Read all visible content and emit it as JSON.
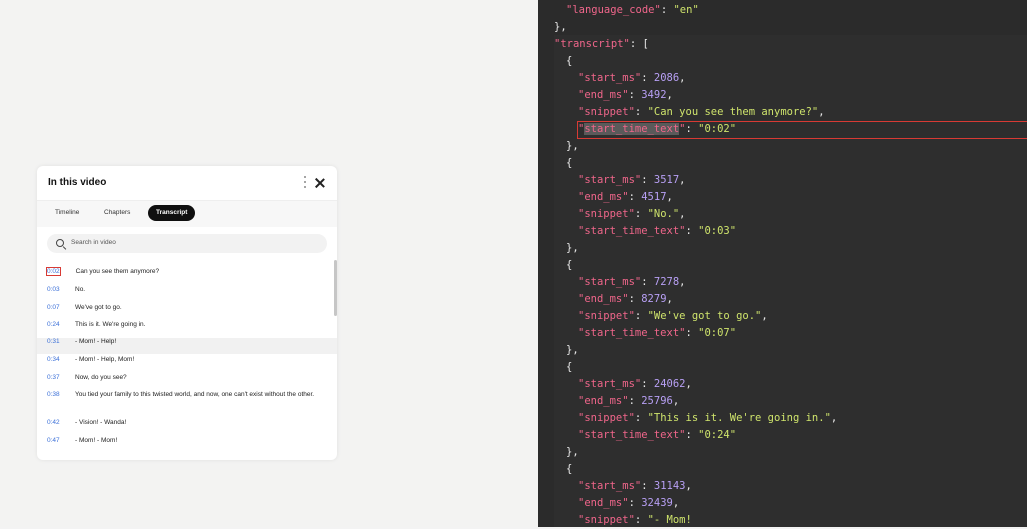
{
  "panel": {
    "title": "In this video",
    "tabs": [
      "Timeline",
      "Chapters",
      "Transcript"
    ],
    "active_tab": "Transcript",
    "search_placeholder": "Search in video",
    "items": [
      {
        "time": "0:02",
        "text": "Can you see them anymore?"
      },
      {
        "time": "0:03",
        "text": "No."
      },
      {
        "time": "0:07",
        "text": "We've got to go."
      },
      {
        "time": "0:24",
        "text": "This is it. We're going in."
      },
      {
        "time": "0:31",
        "text": "- Mom! - Help!"
      },
      {
        "time": "0:34",
        "text": "- Mom! - Help, Mom!"
      },
      {
        "time": "0:37",
        "text": "Now, do you see?"
      },
      {
        "time": "0:38",
        "text": "You tied your family to this twisted world, and now, one can't exist without the other."
      },
      {
        "time": "0:42",
        "text": "- Vision! - Wanda!"
      },
      {
        "time": "0:47",
        "text": "- Mom! - Mom!"
      }
    ]
  },
  "editor": {
    "lines": [
      {
        "indent": 28,
        "parts": [
          [
            "k",
            "\"language_code\""
          ],
          [
            "p",
            ": "
          ],
          [
            "s",
            "\"en\""
          ]
        ]
      },
      {
        "indent": 16,
        "parts": [
          [
            "p",
            "},"
          ]
        ]
      },
      {
        "indent": 16,
        "parts": [
          [
            "k",
            "\"transcript\""
          ],
          [
            "p",
            ": ["
          ]
        ]
      },
      {
        "indent": 28,
        "parts": [
          [
            "p",
            "{"
          ]
        ]
      },
      {
        "indent": 40,
        "parts": [
          [
            "k",
            "\"start_ms\""
          ],
          [
            "p",
            ": "
          ],
          [
            "n",
            "2086"
          ],
          [
            "p",
            ","
          ]
        ]
      },
      {
        "indent": 40,
        "parts": [
          [
            "k",
            "\"end_ms\""
          ],
          [
            "p",
            ": "
          ],
          [
            "n",
            "3492"
          ],
          [
            "p",
            ","
          ]
        ]
      },
      {
        "indent": 40,
        "parts": [
          [
            "k",
            "\"snippet\""
          ],
          [
            "p",
            ": "
          ],
          [
            "s",
            "\"Can you see them anymore?\""
          ],
          [
            "p",
            ","
          ]
        ]
      },
      {
        "indent": 40,
        "parts": [
          [
            "k",
            "\"start_time_text\""
          ],
          [
            "p",
            ": "
          ],
          [
            "s",
            "\"0:02\""
          ]
        ]
      },
      {
        "indent": 28,
        "parts": [
          [
            "p",
            "},"
          ]
        ]
      },
      {
        "indent": 28,
        "parts": [
          [
            "p",
            "{"
          ]
        ]
      },
      {
        "indent": 40,
        "parts": [
          [
            "k",
            "\"start_ms\""
          ],
          [
            "p",
            ": "
          ],
          [
            "n",
            "3517"
          ],
          [
            "p",
            ","
          ]
        ]
      },
      {
        "indent": 40,
        "parts": [
          [
            "k",
            "\"end_ms\""
          ],
          [
            "p",
            ": "
          ],
          [
            "n",
            "4517"
          ],
          [
            "p",
            ","
          ]
        ]
      },
      {
        "indent": 40,
        "parts": [
          [
            "k",
            "\"snippet\""
          ],
          [
            "p",
            ": "
          ],
          [
            "s",
            "\"No.\""
          ],
          [
            "p",
            ","
          ]
        ]
      },
      {
        "indent": 40,
        "parts": [
          [
            "k",
            "\"start_time_text\""
          ],
          [
            "p",
            ": "
          ],
          [
            "s",
            "\"0:03\""
          ]
        ]
      },
      {
        "indent": 28,
        "parts": [
          [
            "p",
            "},"
          ]
        ]
      },
      {
        "indent": 28,
        "parts": [
          [
            "p",
            "{"
          ]
        ]
      },
      {
        "indent": 40,
        "parts": [
          [
            "k",
            "\"start_ms\""
          ],
          [
            "p",
            ": "
          ],
          [
            "n",
            "7278"
          ],
          [
            "p",
            ","
          ]
        ]
      },
      {
        "indent": 40,
        "parts": [
          [
            "k",
            "\"end_ms\""
          ],
          [
            "p",
            ": "
          ],
          [
            "n",
            "8279"
          ],
          [
            "p",
            ","
          ]
        ]
      },
      {
        "indent": 40,
        "parts": [
          [
            "k",
            "\"snippet\""
          ],
          [
            "p",
            ": "
          ],
          [
            "s",
            "\"We've got to go.\""
          ],
          [
            "p",
            ","
          ]
        ]
      },
      {
        "indent": 40,
        "parts": [
          [
            "k",
            "\"start_time_text\""
          ],
          [
            "p",
            ": "
          ],
          [
            "s",
            "\"0:07\""
          ]
        ]
      },
      {
        "indent": 28,
        "parts": [
          [
            "p",
            "},"
          ]
        ]
      },
      {
        "indent": 28,
        "parts": [
          [
            "p",
            "{"
          ]
        ]
      },
      {
        "indent": 40,
        "parts": [
          [
            "k",
            "\"start_ms\""
          ],
          [
            "p",
            ": "
          ],
          [
            "n",
            "24062"
          ],
          [
            "p",
            ","
          ]
        ]
      },
      {
        "indent": 40,
        "parts": [
          [
            "k",
            "\"end_ms\""
          ],
          [
            "p",
            ": "
          ],
          [
            "n",
            "25796"
          ],
          [
            "p",
            ","
          ]
        ]
      },
      {
        "indent": 40,
        "parts": [
          [
            "k",
            "\"snippet\""
          ],
          [
            "p",
            ": "
          ],
          [
            "s",
            "\"This is it. We're going in.\""
          ],
          [
            "p",
            ","
          ]
        ]
      },
      {
        "indent": 40,
        "parts": [
          [
            "k",
            "\"start_time_text\""
          ],
          [
            "p",
            ": "
          ],
          [
            "s",
            "\"0:24\""
          ]
        ]
      },
      {
        "indent": 28,
        "parts": [
          [
            "p",
            "},"
          ]
        ]
      },
      {
        "indent": 28,
        "parts": [
          [
            "p",
            "{"
          ]
        ]
      },
      {
        "indent": 40,
        "parts": [
          [
            "k",
            "\"start_ms\""
          ],
          [
            "p",
            ": "
          ],
          [
            "n",
            "31143"
          ],
          [
            "p",
            ","
          ]
        ]
      },
      {
        "indent": 40,
        "parts": [
          [
            "k",
            "\"end_ms\""
          ],
          [
            "p",
            ": "
          ],
          [
            "n",
            "32439"
          ],
          [
            "p",
            ","
          ]
        ]
      },
      {
        "indent": 40,
        "parts": [
          [
            "k",
            "\"snippet\""
          ],
          [
            "p",
            ": "
          ],
          [
            "s",
            "\"- Mom!"
          ]
        ]
      }
    ]
  }
}
